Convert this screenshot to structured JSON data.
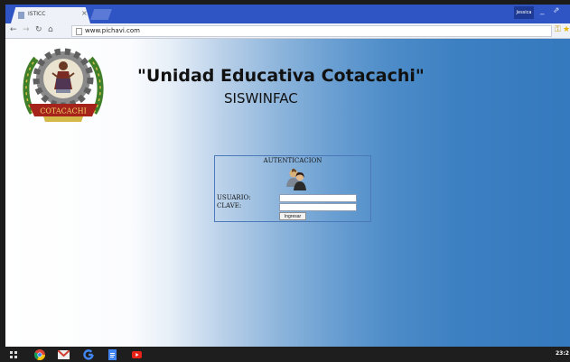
{
  "browser": {
    "tab_title": "ISTICC",
    "profile_name": "Jessica",
    "url": "www.pichavi.com"
  },
  "page": {
    "title": "\"Unidad Educativa Cotacachi\"",
    "subtitle": "SISWINFAC",
    "logo_text": "COTACACHI",
    "auth": {
      "heading": "AUTENTICACION",
      "user_label": "USUARIO:",
      "password_label": "CLAVE:",
      "user_value": "",
      "password_value": "",
      "submit_label": "Ingresar"
    }
  },
  "taskbar": {
    "clock": "23:2",
    "icons": [
      "apps-icon",
      "chrome-icon",
      "gmail-icon",
      "google-icon",
      "docs-icon",
      "youtube-icon"
    ]
  },
  "colors": {
    "tabstrip": "#2f55c4",
    "page_gradient_end": "#3579be",
    "form_border": "#4a78b8"
  }
}
